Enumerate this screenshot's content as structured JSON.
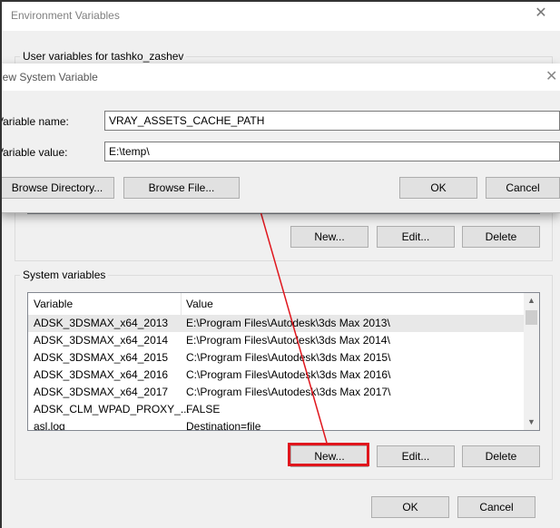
{
  "env_dialog": {
    "title": "Environment Variables",
    "user_group_label": "User variables for tashko_zashev",
    "user_buttons": {
      "new": "New...",
      "edit": "Edit...",
      "delete": "Delete"
    },
    "system_group_label": "System variables",
    "system_columns": {
      "variable": "Variable",
      "value": "Value"
    },
    "system_rows": [
      {
        "variable": "ADSK_3DSMAX_x64_2013",
        "value": "E:\\Program Files\\Autodesk\\3ds Max 2013\\"
      },
      {
        "variable": "ADSK_3DSMAX_x64_2014",
        "value": "E:\\Program Files\\Autodesk\\3ds Max 2014\\"
      },
      {
        "variable": "ADSK_3DSMAX_x64_2015",
        "value": "C:\\Program Files\\Autodesk\\3ds Max 2015\\"
      },
      {
        "variable": "ADSK_3DSMAX_x64_2016",
        "value": "C:\\Program Files\\Autodesk\\3ds Max 2016\\"
      },
      {
        "variable": "ADSK_3DSMAX_x64_2017",
        "value": "C:\\Program Files\\Autodesk\\3ds Max 2017\\"
      },
      {
        "variable": "ADSK_CLM_WPAD_PROXY_...",
        "value": "FALSE"
      },
      {
        "variable": "asl.log",
        "value": "Destination=file"
      }
    ],
    "system_buttons": {
      "new": "New...",
      "edit": "Edit...",
      "delete": "Delete"
    },
    "ok": "OK",
    "cancel": "Cancel"
  },
  "new_var_dialog": {
    "title": "New System Variable",
    "name_label": "Variable name:",
    "name_value": "VRAY_ASSETS_CACHE_PATH",
    "value_label": "Variable value:",
    "value_value": "E:\\temp\\",
    "browse_directory": "Browse Directory...",
    "browse_file": "Browse File...",
    "ok": "OK",
    "cancel": "Cancel"
  },
  "colors": {
    "highlight": "#e0161d"
  }
}
